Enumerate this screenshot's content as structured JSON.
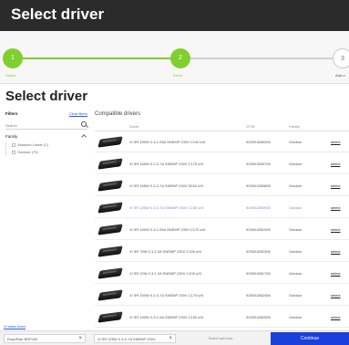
{
  "header": {
    "title": "Select driver"
  },
  "stepper": {
    "steps": [
      {
        "number": "1",
        "label": "Select"
      },
      {
        "number": "2",
        "label": "Driver"
      },
      {
        "number": "3",
        "label": "Add-o"
      }
    ]
  },
  "page_title": "Select driver",
  "filters": {
    "title": "Filters",
    "clear_label": "Clear filters",
    "search_placeholder": "Search",
    "group_title": "Family",
    "items": [
      {
        "label": "Xitanium Linear (2)"
      },
      {
        "label": "Outdoor (79)"
      }
    ]
  },
  "main": {
    "title": "Compatible drivers",
    "columns": {
      "driver": "Driver",
      "gtin": "GTIN",
      "family": "Family"
    },
    "rows": [
      {
        "description": "Xi SR 150W 0.3-1.05A SNEMP 230V C140 sXt",
        "gtin": "929001850306",
        "family": "Outdoor",
        "action": "select"
      },
      {
        "description": "Xi SR 165W 0.2-0.7A SNEMP 230V C170 sXt",
        "gtin": "929001850706",
        "family": "Outdoor",
        "action": "select"
      },
      {
        "description": "Xi SR 165W 0.2-0.7A SNEMP 230V S240 sXt",
        "gtin": "929001850806",
        "family": "Outdoor",
        "action": "select"
      },
      {
        "description": "Xi SR 225W 0.2-0.7A SNEMP 230V C150 sXt",
        "gtin": "929001850906",
        "family": "Outdoor",
        "action": "select"
      },
      {
        "description": "Xi SR 150W 0.3-1.05A SNEMP 230V C170 sXt",
        "gtin": "929001851006",
        "family": "Outdoor",
        "action": "select"
      },
      {
        "description": "Xi SR 75W 0.3-1.0A SNEMP 230V C150 sXt",
        "gtin": "929001852306",
        "family": "Outdoor",
        "action": "select"
      },
      {
        "description": "Xi SR 22W 0.3-1.0A SNEMP 230V C100 sXt",
        "gtin": "929001851706",
        "family": "Outdoor",
        "action": "select"
      },
      {
        "description": "Xi SR 150W 0.2-0.7A SNEMP 230V C170 sXt",
        "gtin": "929001852406",
        "family": "Outdoor",
        "action": "select"
      },
      {
        "description": "Xi SR 150W 0.3-1.0A SNEMP 230V C150 sXt",
        "gtin": "929001852506",
        "family": "Outdoor",
        "action": "select"
      }
    ]
  },
  "bottom_link": "Xi sales team",
  "footer": {
    "chip1": "RoadFlair BRP430",
    "chip2": "Xi SR 225W 0.3-0.7A SNEMP 230V",
    "select_add_ons": "Select add-ons",
    "continue": "Continue"
  },
  "colors": {
    "accent_green": "#7fcf2f",
    "primary_blue": "#1a3fdb",
    "header_bg": "#2b2b2b"
  }
}
